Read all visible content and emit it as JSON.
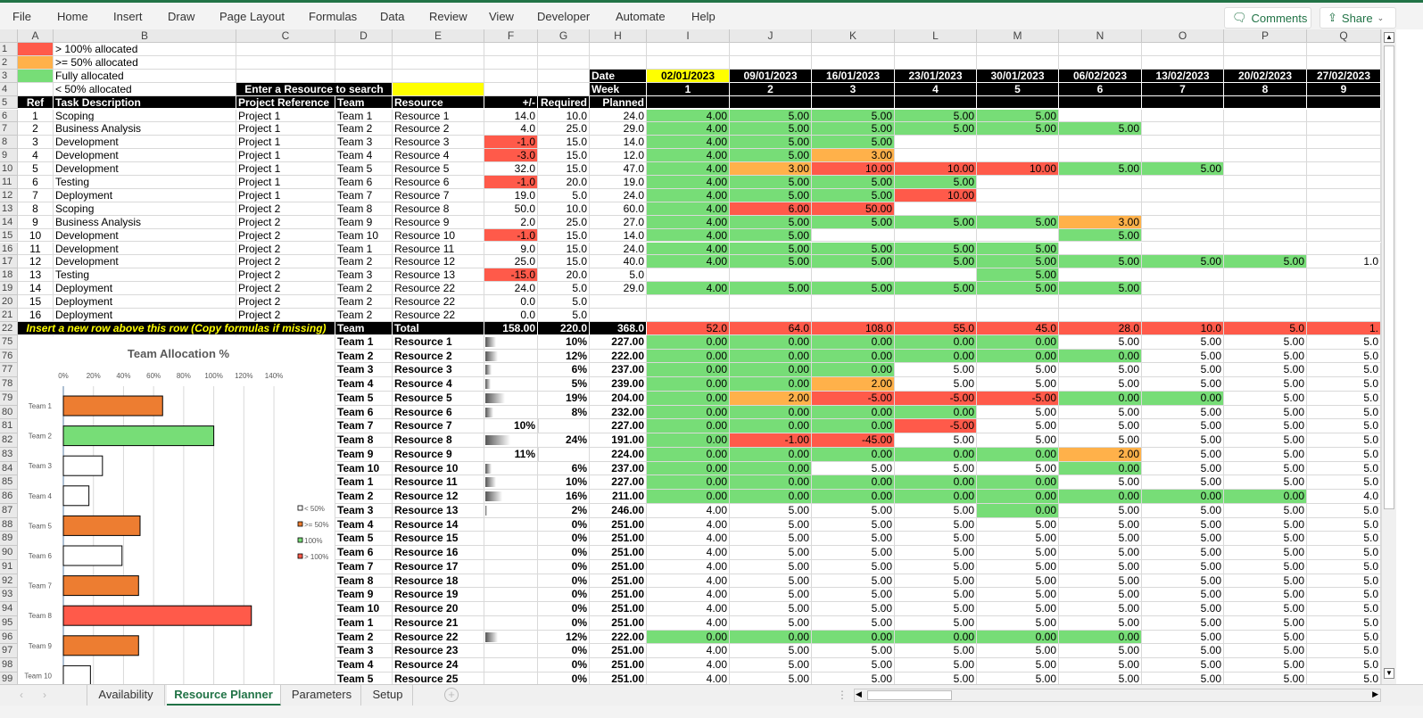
{
  "menu": [
    "File",
    "Home",
    "Insert",
    "Draw",
    "Page Layout",
    "Formulas",
    "Data",
    "Review",
    "View",
    "Developer",
    "Automate",
    "Help"
  ],
  "ribbon": {
    "comments": "Comments",
    "share": "Share"
  },
  "columns": [
    "A",
    "B",
    "C",
    "D",
    "E",
    "F",
    "G",
    "H",
    "I",
    "J",
    "K",
    "L",
    "M",
    "N",
    "O",
    "P",
    "Q"
  ],
  "legend": [
    {
      "label": "> 100% allocated",
      "color": "#ff5a4a"
    },
    {
      "label": ">= 50% allocated",
      "color": "#ffb14a"
    },
    {
      "label": "Fully allocated",
      "color": "#77dd77"
    },
    {
      "label": "< 50% allocated",
      "color": "#ffffff"
    }
  ],
  "search": {
    "label": "Enter a Resource to search",
    "value": ""
  },
  "timeline": {
    "date_label": "Date",
    "week_label": "Week",
    "dates": [
      "02/01/2023",
      "09/01/2023",
      "16/01/2023",
      "23/01/2023",
      "30/01/2023",
      "06/02/2023",
      "13/02/2023",
      "20/02/2023",
      "27/02/2023"
    ],
    "weeks": [
      "1",
      "2",
      "3",
      "4",
      "5",
      "6",
      "7",
      "8",
      "9"
    ]
  },
  "headers": [
    "Ref",
    "Task Description",
    "Project Reference",
    "Team",
    "Resource",
    "+/-",
    "Required",
    "Planned"
  ],
  "tasks": [
    {
      "cells": [
        "1",
        "Scoping",
        "Project 1",
        "Team 1",
        "Resource 1",
        "14.0",
        "10.0",
        "24.0"
      ],
      "weeks": [
        "4.00",
        "5.00",
        "5.00",
        "5.00",
        "5.00",
        "",
        "",
        "",
        ""
      ],
      "status": "ggggg"
    },
    {
      "cells": [
        "2",
        "Business Analysis",
        "Project 1",
        "Team 2",
        "Resource 2",
        "4.0",
        "25.0",
        "29.0"
      ],
      "weeks": [
        "4.00",
        "5.00",
        "5.00",
        "5.00",
        "5.00",
        "5.00",
        "",
        "",
        ""
      ],
      "status": "gggggg"
    },
    {
      "cells": [
        "3",
        "Development",
        "Project 1",
        "Team 3",
        "Resource 3",
        "-1.0",
        "15.0",
        "14.0"
      ],
      "weeks": [
        "4.00",
        "5.00",
        "5.00",
        "",
        "",
        "",
        "",
        "",
        ""
      ],
      "status": "ggg"
    },
    {
      "cells": [
        "4",
        "Development",
        "Project 1",
        "Team 4",
        "Resource 4",
        "-3.0",
        "15.0",
        "12.0"
      ],
      "weeks": [
        "4.00",
        "5.00",
        "3.00",
        "",
        "",
        "",
        "",
        "",
        ""
      ],
      "status": "ggo"
    },
    {
      "cells": [
        "5",
        "Development",
        "Project 1",
        "Team 5",
        "Resource 5",
        "32.0",
        "15.0",
        "47.0"
      ],
      "weeks": [
        "4.00",
        "3.00",
        "10.00",
        "10.00",
        "10.00",
        "5.00",
        "5.00",
        "",
        ""
      ],
      "status": "gorrrgg"
    },
    {
      "cells": [
        "6",
        "Testing",
        "Project 1",
        "Team 6",
        "Resource 6",
        "-1.0",
        "20.0",
        "19.0"
      ],
      "weeks": [
        "4.00",
        "5.00",
        "5.00",
        "5.00",
        "",
        "",
        "",
        "",
        ""
      ],
      "status": "gggg"
    },
    {
      "cells": [
        "7",
        "Deployment",
        "Project 1",
        "Team 7",
        "Resource 7",
        "19.0",
        "5.0",
        "24.0"
      ],
      "weeks": [
        "4.00",
        "5.00",
        "5.00",
        "10.00",
        "",
        "",
        "",
        "",
        ""
      ],
      "status": "gggr"
    },
    {
      "cells": [
        "8",
        "Scoping",
        "Project 2",
        "Team 8",
        "Resource 8",
        "50.0",
        "10.0",
        "60.0"
      ],
      "weeks": [
        "4.00",
        "6.00",
        "50.00",
        "",
        "",
        "",
        "",
        "",
        ""
      ],
      "status": "grr"
    },
    {
      "cells": [
        "9",
        "Business Analysis",
        "Project 2",
        "Team 9",
        "Resource 9",
        "2.0",
        "25.0",
        "27.0"
      ],
      "weeks": [
        "4.00",
        "5.00",
        "5.00",
        "5.00",
        "5.00",
        "3.00",
        "",
        "",
        ""
      ],
      "status": "gggggo"
    },
    {
      "cells": [
        "10",
        "Development",
        "Project 2",
        "Team 10",
        "Resource 10",
        "-1.0",
        "15.0",
        "14.0"
      ],
      "weeks": [
        "4.00",
        "5.00",
        "",
        "",
        "",
        "5.00",
        "",
        "",
        ""
      ],
      "status": "gg...g"
    },
    {
      "cells": [
        "11",
        "Development",
        "Project 2",
        "Team 1",
        "Resource 11",
        "9.0",
        "15.0",
        "24.0"
      ],
      "weeks": [
        "4.00",
        "5.00",
        "5.00",
        "5.00",
        "5.00",
        "",
        "",
        "",
        ""
      ],
      "status": "ggggg"
    },
    {
      "cells": [
        "12",
        "Development",
        "Project 2",
        "Team 2",
        "Resource 12",
        "25.0",
        "15.0",
        "40.0"
      ],
      "weeks": [
        "4.00",
        "5.00",
        "5.00",
        "5.00",
        "5.00",
        "5.00",
        "5.00",
        "5.00",
        "1.0"
      ],
      "status": "gggggggg"
    },
    {
      "cells": [
        "13",
        "Testing",
        "Project 2",
        "Team 3",
        "Resource 13",
        "-15.0",
        "20.0",
        "5.0"
      ],
      "weeks": [
        "",
        "",
        "",
        "",
        "5.00",
        "",
        "",
        "",
        ""
      ],
      "status": "....g"
    },
    {
      "cells": [
        "14",
        "Deployment",
        "Project 2",
        "Team 2",
        "Resource 22",
        "24.0",
        "5.0",
        "29.0"
      ],
      "weeks": [
        "4.00",
        "5.00",
        "5.00",
        "5.00",
        "5.00",
        "5.00",
        "",
        "",
        ""
      ],
      "status": "gggggg"
    },
    {
      "cells": [
        "15",
        "Deployment",
        "Project 2",
        "Team 2",
        "Resource 22",
        "0.0",
        "5.0",
        ""
      ],
      "weeks": [
        "",
        "",
        "",
        "",
        "",
        "",
        "",
        "",
        ""
      ],
      "status": ""
    },
    {
      "cells": [
        "16",
        "Deployment",
        "Project 2",
        "Team 2",
        "Resource 22",
        "0.0",
        "5.0",
        ""
      ],
      "weeks": [
        "",
        "",
        "",
        "",
        "",
        "",
        "",
        "",
        ""
      ],
      "status": ""
    }
  ],
  "totals": {
    "note": "Insert a new row above this row (Copy formulas if missing)",
    "team": "Team",
    "label": "Total",
    "diff": "158.00",
    "required": "220.0",
    "planned": "368.0",
    "weeks": [
      "52.0",
      "64.0",
      "108.0",
      "55.0",
      "45.0",
      "28.0",
      "10.0",
      "5.0",
      "1."
    ]
  },
  "resources": [
    {
      "row": "75",
      "team": "Team 1",
      "resource": "Resource 1",
      "bar": 10,
      "pct": "10%",
      "pct_in_f": false,
      "planned": "227.00",
      "weeks": [
        "0.00",
        "0.00",
        "0.00",
        "0.00",
        "0.00",
        "5.00",
        "5.00",
        "5.00",
        "5.0"
      ],
      "status": "ggggg"
    },
    {
      "row": "76",
      "team": "Team 2",
      "resource": "Resource 2",
      "bar": 12,
      "pct": "12%",
      "pct_in_f": false,
      "planned": "222.00",
      "weeks": [
        "0.00",
        "0.00",
        "0.00",
        "0.00",
        "0.00",
        "0.00",
        "5.00",
        "5.00",
        "5.0"
      ],
      "status": "gggggg"
    },
    {
      "row": "77",
      "team": "Team 3",
      "resource": "Resource 3",
      "bar": 6,
      "pct": "6%",
      "pct_in_f": false,
      "planned": "237.00",
      "weeks": [
        "0.00",
        "0.00",
        "0.00",
        "5.00",
        "5.00",
        "5.00",
        "5.00",
        "5.00",
        "5.0"
      ],
      "status": "ggg"
    },
    {
      "row": "78",
      "team": "Team 4",
      "resource": "Resource 4",
      "bar": 5,
      "pct": "5%",
      "pct_in_f": false,
      "planned": "239.00",
      "weeks": [
        "0.00",
        "0.00",
        "2.00",
        "5.00",
        "5.00",
        "5.00",
        "5.00",
        "5.00",
        "5.0"
      ],
      "status": "ggo"
    },
    {
      "row": "79",
      "team": "Team 5",
      "resource": "Resource 5",
      "bar": 19,
      "pct": "19%",
      "pct_in_f": false,
      "planned": "204.00",
      "weeks": [
        "0.00",
        "2.00",
        "-5.00",
        "-5.00",
        "-5.00",
        "0.00",
        "0.00",
        "5.00",
        "5.0"
      ],
      "status": "gorrrgg"
    },
    {
      "row": "80",
      "team": "Team 6",
      "resource": "Resource 6",
      "bar": 8,
      "pct": "8%",
      "pct_in_f": false,
      "planned": "232.00",
      "weeks": [
        "0.00",
        "0.00",
        "0.00",
        "0.00",
        "5.00",
        "5.00",
        "5.00",
        "5.00",
        "5.0"
      ],
      "status": "gggg"
    },
    {
      "row": "81",
      "team": "Team 7",
      "resource": "Resource 7",
      "bar": 10,
      "pct": "10%",
      "pct_in_f": true,
      "planned": "227.00",
      "weeks": [
        "0.00",
        "0.00",
        "0.00",
        "-5.00",
        "5.00",
        "5.00",
        "5.00",
        "5.00",
        "5.0"
      ],
      "status": "gggr"
    },
    {
      "row": "82",
      "team": "Team 8",
      "resource": "Resource 8",
      "bar": 24,
      "pct": "24%",
      "pct_in_f": false,
      "planned": "191.00",
      "weeks": [
        "0.00",
        "-1.00",
        "-45.00",
        "5.00",
        "5.00",
        "5.00",
        "5.00",
        "5.00",
        "5.0"
      ],
      "status": "grr"
    },
    {
      "row": "83",
      "team": "Team 9",
      "resource": "Resource 9",
      "bar": 11,
      "pct": "11%",
      "pct_in_f": true,
      "planned": "224.00",
      "weeks": [
        "0.00",
        "0.00",
        "0.00",
        "0.00",
        "0.00",
        "2.00",
        "5.00",
        "5.00",
        "5.0"
      ],
      "status": "gggggo"
    },
    {
      "row": "84",
      "team": "Team 10",
      "resource": "Resource 10",
      "bar": 6,
      "pct": "6%",
      "pct_in_f": false,
      "planned": "237.00",
      "weeks": [
        "0.00",
        "0.00",
        "5.00",
        "5.00",
        "5.00",
        "0.00",
        "5.00",
        "5.00",
        "5.0"
      ],
      "status": "gg...g"
    },
    {
      "row": "85",
      "team": "Team 1",
      "resource": "Resource 11",
      "bar": 10,
      "pct": "10%",
      "pct_in_f": false,
      "planned": "227.00",
      "weeks": [
        "0.00",
        "0.00",
        "0.00",
        "0.00",
        "0.00",
        "5.00",
        "5.00",
        "5.00",
        "5.0"
      ],
      "status": "ggggg"
    },
    {
      "row": "86",
      "team": "Team 2",
      "resource": "Resource 12",
      "bar": 16,
      "pct": "16%",
      "pct_in_f": false,
      "planned": "211.00",
      "weeks": [
        "0.00",
        "0.00",
        "0.00",
        "0.00",
        "0.00",
        "0.00",
        "0.00",
        "0.00",
        "4.0"
      ],
      "status": "gggggggg"
    },
    {
      "row": "87",
      "team": "Team 3",
      "resource": "Resource 13",
      "bar": 2,
      "pct": "2%",
      "pct_in_f": false,
      "planned": "246.00",
      "weeks": [
        "4.00",
        "5.00",
        "5.00",
        "5.00",
        "0.00",
        "5.00",
        "5.00",
        "5.00",
        "5.0"
      ],
      "status": "....g"
    },
    {
      "row": "88",
      "team": "Team 4",
      "resource": "Resource 14",
      "bar": 0,
      "pct": "0%",
      "pct_in_f": false,
      "planned": "251.00",
      "weeks": [
        "4.00",
        "5.00",
        "5.00",
        "5.00",
        "5.00",
        "5.00",
        "5.00",
        "5.00",
        "5.0"
      ],
      "status": ""
    },
    {
      "row": "89",
      "team": "Team 5",
      "resource": "Resource 15",
      "bar": 0,
      "pct": "0%",
      "pct_in_f": false,
      "planned": "251.00",
      "weeks": [
        "4.00",
        "5.00",
        "5.00",
        "5.00",
        "5.00",
        "5.00",
        "5.00",
        "5.00",
        "5.0"
      ],
      "status": ""
    },
    {
      "row": "90",
      "team": "Team 6",
      "resource": "Resource 16",
      "bar": 0,
      "pct": "0%",
      "pct_in_f": false,
      "planned": "251.00",
      "weeks": [
        "4.00",
        "5.00",
        "5.00",
        "5.00",
        "5.00",
        "5.00",
        "5.00",
        "5.00",
        "5.0"
      ],
      "status": ""
    },
    {
      "row": "91",
      "team": "Team 7",
      "resource": "Resource 17",
      "bar": 0,
      "pct": "0%",
      "pct_in_f": false,
      "planned": "251.00",
      "weeks": [
        "4.00",
        "5.00",
        "5.00",
        "5.00",
        "5.00",
        "5.00",
        "5.00",
        "5.00",
        "5.0"
      ],
      "status": ""
    },
    {
      "row": "92",
      "team": "Team 8",
      "resource": "Resource 18",
      "bar": 0,
      "pct": "0%",
      "pct_in_f": false,
      "planned": "251.00",
      "weeks": [
        "4.00",
        "5.00",
        "5.00",
        "5.00",
        "5.00",
        "5.00",
        "5.00",
        "5.00",
        "5.0"
      ],
      "status": ""
    },
    {
      "row": "93",
      "team": "Team 9",
      "resource": "Resource 19",
      "bar": 0,
      "pct": "0%",
      "pct_in_f": false,
      "planned": "251.00",
      "weeks": [
        "4.00",
        "5.00",
        "5.00",
        "5.00",
        "5.00",
        "5.00",
        "5.00",
        "5.00",
        "5.0"
      ],
      "status": ""
    },
    {
      "row": "94",
      "team": "Team 10",
      "resource": "Resource 20",
      "bar": 0,
      "pct": "0%",
      "pct_in_f": false,
      "planned": "251.00",
      "weeks": [
        "4.00",
        "5.00",
        "5.00",
        "5.00",
        "5.00",
        "5.00",
        "5.00",
        "5.00",
        "5.0"
      ],
      "status": ""
    },
    {
      "row": "95",
      "team": "Team 1",
      "resource": "Resource 21",
      "bar": 0,
      "pct": "0%",
      "pct_in_f": false,
      "planned": "251.00",
      "weeks": [
        "4.00",
        "5.00",
        "5.00",
        "5.00",
        "5.00",
        "5.00",
        "5.00",
        "5.00",
        "5.0"
      ],
      "status": ""
    },
    {
      "row": "96",
      "team": "Team 2",
      "resource": "Resource 22",
      "bar": 12,
      "pct": "12%",
      "pct_in_f": false,
      "planned": "222.00",
      "weeks": [
        "0.00",
        "0.00",
        "0.00",
        "0.00",
        "0.00",
        "0.00",
        "5.00",
        "5.00",
        "5.0"
      ],
      "status": "gggggg"
    },
    {
      "row": "97",
      "team": "Team 3",
      "resource": "Resource 23",
      "bar": 0,
      "pct": "0%",
      "pct_in_f": false,
      "planned": "251.00",
      "weeks": [
        "4.00",
        "5.00",
        "5.00",
        "5.00",
        "5.00",
        "5.00",
        "5.00",
        "5.00",
        "5.0"
      ],
      "status": ""
    },
    {
      "row": "98",
      "team": "Team 4",
      "resource": "Resource 24",
      "bar": 0,
      "pct": "0%",
      "pct_in_f": false,
      "planned": "251.00",
      "weeks": [
        "4.00",
        "5.00",
        "5.00",
        "5.00",
        "5.00",
        "5.00",
        "5.00",
        "5.00",
        "5.0"
      ],
      "status": ""
    },
    {
      "row": "99",
      "team": "Team 5",
      "resource": "Resource 25",
      "bar": 0,
      "pct": "0%",
      "pct_in_f": false,
      "planned": "251.00",
      "weeks": [
        "4.00",
        "5.00",
        "5.00",
        "5.00",
        "5.00",
        "5.00",
        "5.00",
        "5.00",
        "5.0"
      ],
      "status": ""
    }
  ],
  "status_colors": {
    "g": "#77dd77",
    "o": "#ffb14a",
    "r": "#ff5a4a"
  },
  "chart_data": {
    "type": "bar",
    "orientation": "horizontal",
    "title": "Team Allocation %",
    "categories": [
      "Team 1",
      "Team 2",
      "Team 3",
      "Team 4",
      "Team 5",
      "Team 6",
      "Team 7",
      "Team 8",
      "Team 9",
      "Team 10"
    ],
    "values": [
      66,
      100,
      26,
      17,
      51,
      39,
      50,
      125,
      50,
      18
    ],
    "classes": [
      "ge50",
      "full",
      "lt50",
      "lt50",
      "ge50",
      "lt50",
      "ge50",
      "gt100",
      "ge50",
      "lt50"
    ],
    "xticks": [
      "0%",
      "20%",
      "40%",
      "60%",
      "80%",
      "100%",
      "120%",
      "140%"
    ],
    "xlim": [
      0,
      140
    ],
    "grid": true,
    "legend_position": "right",
    "legend": [
      {
        "key": "lt50",
        "label": "< 50%",
        "color": "#ffffff"
      },
      {
        "key": "ge50",
        "label": ">= 50%",
        "color": "#ed7d31"
      },
      {
        "key": "full",
        "label": "100%",
        "color": "#77dd77"
      },
      {
        "key": "gt100",
        "label": "> 100%",
        "color": "#ff5a4a"
      }
    ]
  },
  "sheets": [
    {
      "label": "Availability",
      "active": false
    },
    {
      "label": "Resource Planner",
      "active": true
    },
    {
      "label": "Parameters",
      "active": false
    },
    {
      "label": "Setup",
      "active": false
    }
  ]
}
